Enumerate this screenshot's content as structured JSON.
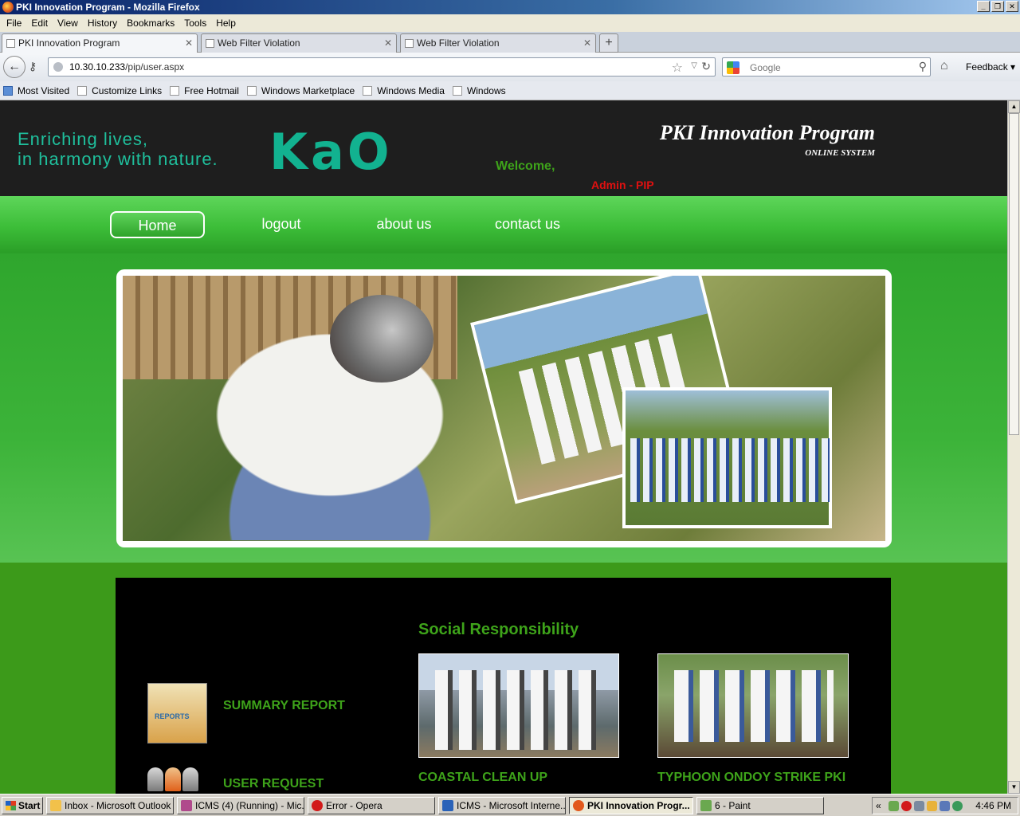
{
  "window": {
    "title": "PKI Innovation Program - Mozilla Firefox"
  },
  "menu": [
    "File",
    "Edit",
    "View",
    "History",
    "Bookmarks",
    "Tools",
    "Help"
  ],
  "tabs": [
    {
      "label": "PKI Innovation Program",
      "active": true
    },
    {
      "label": "Web Filter Violation",
      "active": false
    },
    {
      "label": "Web Filter Violation",
      "active": false
    }
  ],
  "address": {
    "host": "10.30.10.233",
    "path": "/pip/user.aspx"
  },
  "search": {
    "placeholder": "Google"
  },
  "toolbar": {
    "feedback": "Feedback"
  },
  "bookmarks": [
    "Most Visited",
    "Customize Links",
    "Free Hotmail",
    "Windows Marketplace",
    "Windows Media",
    "Windows"
  ],
  "site": {
    "tagline_line1": "Enriching lives,",
    "tagline_line2": "in harmony with nature.",
    "logo": "KaO",
    "title": "PKI Innovation Program",
    "subtitle": "ONLINE SYSTEM",
    "welcome": "Welcome,",
    "user": "Admin - PIP",
    "nav": [
      "Home",
      "logout",
      "about us",
      "contact us"
    ],
    "section_title": "Social Responsibility",
    "reports_icon_text": "REPORTS",
    "summary_report": "SUMMARY REPORT",
    "user_request": "USER REQUEST",
    "caption1": "COASTAL CLEAN UP",
    "caption2": "TYPHOON ONDOY STRIKE PKI"
  },
  "taskbar": {
    "start": "Start",
    "items": [
      {
        "label": "Inbox - Microsoft Outlook",
        "color": "#f2c14a"
      },
      {
        "label": "ICMS (4) (Running) - Mic...",
        "color": "#b04a8c"
      },
      {
        "label": "Error - Opera",
        "color": "#d21a1a"
      },
      {
        "label": "ICMS - Microsoft Interne...",
        "color": "#2a62b8"
      },
      {
        "label": "PKI Innovation Progr...",
        "color": "#e2581c"
      },
      {
        "label": "6 - Paint",
        "color": "#6aa84f"
      }
    ],
    "clock": "4:46 PM"
  },
  "colors": {
    "accent_green": "#3ea31a",
    "admin_red": "#e01010",
    "logo_teal": "#12b290"
  }
}
